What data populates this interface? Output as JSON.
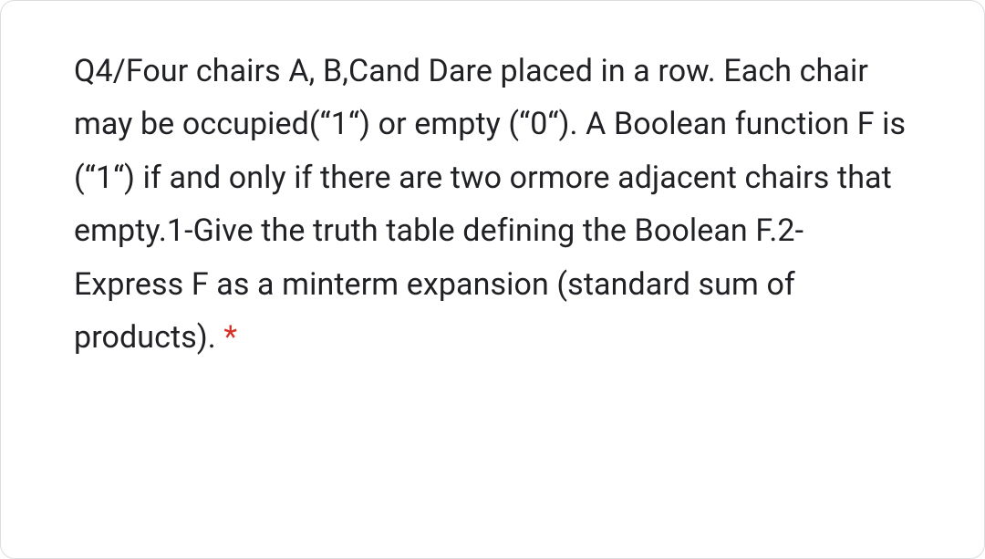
{
  "question": {
    "text": "Q4/Four chairs A, B,Cand Dare placed in a row. Each chair may be occupied(“1“) or empty (“0“). A Boolean function F is (“1“) if and only if there are two ormore adjacent chairs that empty.1-Give the truth table defining the Boolean F.2-Express F as a minterm expansion (standard sum of products). ",
    "required_marker": "*"
  }
}
